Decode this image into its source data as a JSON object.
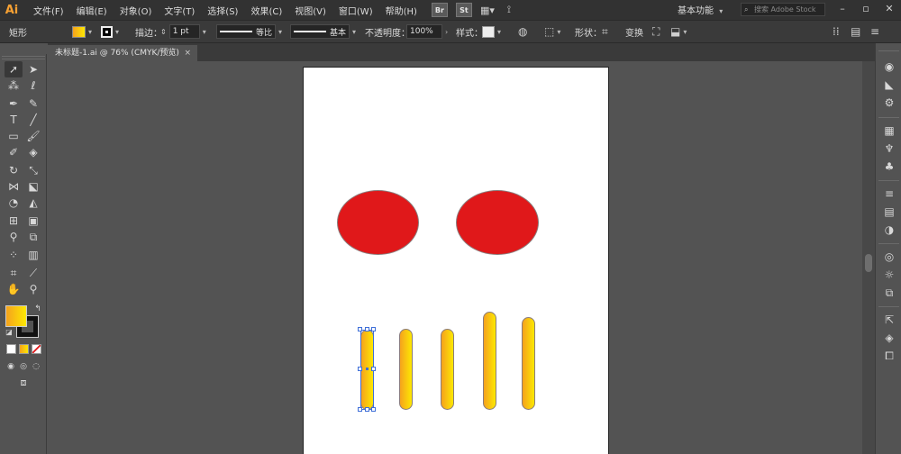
{
  "app": {
    "logo": "Ai"
  },
  "menu": {
    "items": [
      "文件(F)",
      "编辑(E)",
      "对象(O)",
      "文字(T)",
      "选择(S)",
      "效果(C)",
      "视图(V)",
      "窗口(W)",
      "帮助(H)"
    ],
    "bridge_badge": "Br",
    "stock_badge": "St",
    "workspace": "基本功能",
    "search_placeholder": "搜索 Adobe Stock"
  },
  "control": {
    "object_type": "矩形",
    "stroke_label": "描边：",
    "stroke_weight": "1 pt",
    "profile_label": "等比",
    "brush_label": "基本",
    "opacity_label": "不透明度：",
    "opacity_value": "100%",
    "style_label": "样式：",
    "shape_label": "形状：",
    "transform_label": "变换"
  },
  "document": {
    "tab_title": "未标题-1.ai @ 76% (CMYK/预览)",
    "close_glyph": "×"
  },
  "colors": {
    "fill_gradient": [
      "#f5a21d",
      "#fde802"
    ],
    "ellipse_fill": "#e0181a",
    "selection": "#3f6fd8"
  },
  "artwork": {
    "ellipses": 2,
    "bars": 5,
    "bar_gradient": [
      "#f5a21d",
      "#fde802"
    ]
  }
}
